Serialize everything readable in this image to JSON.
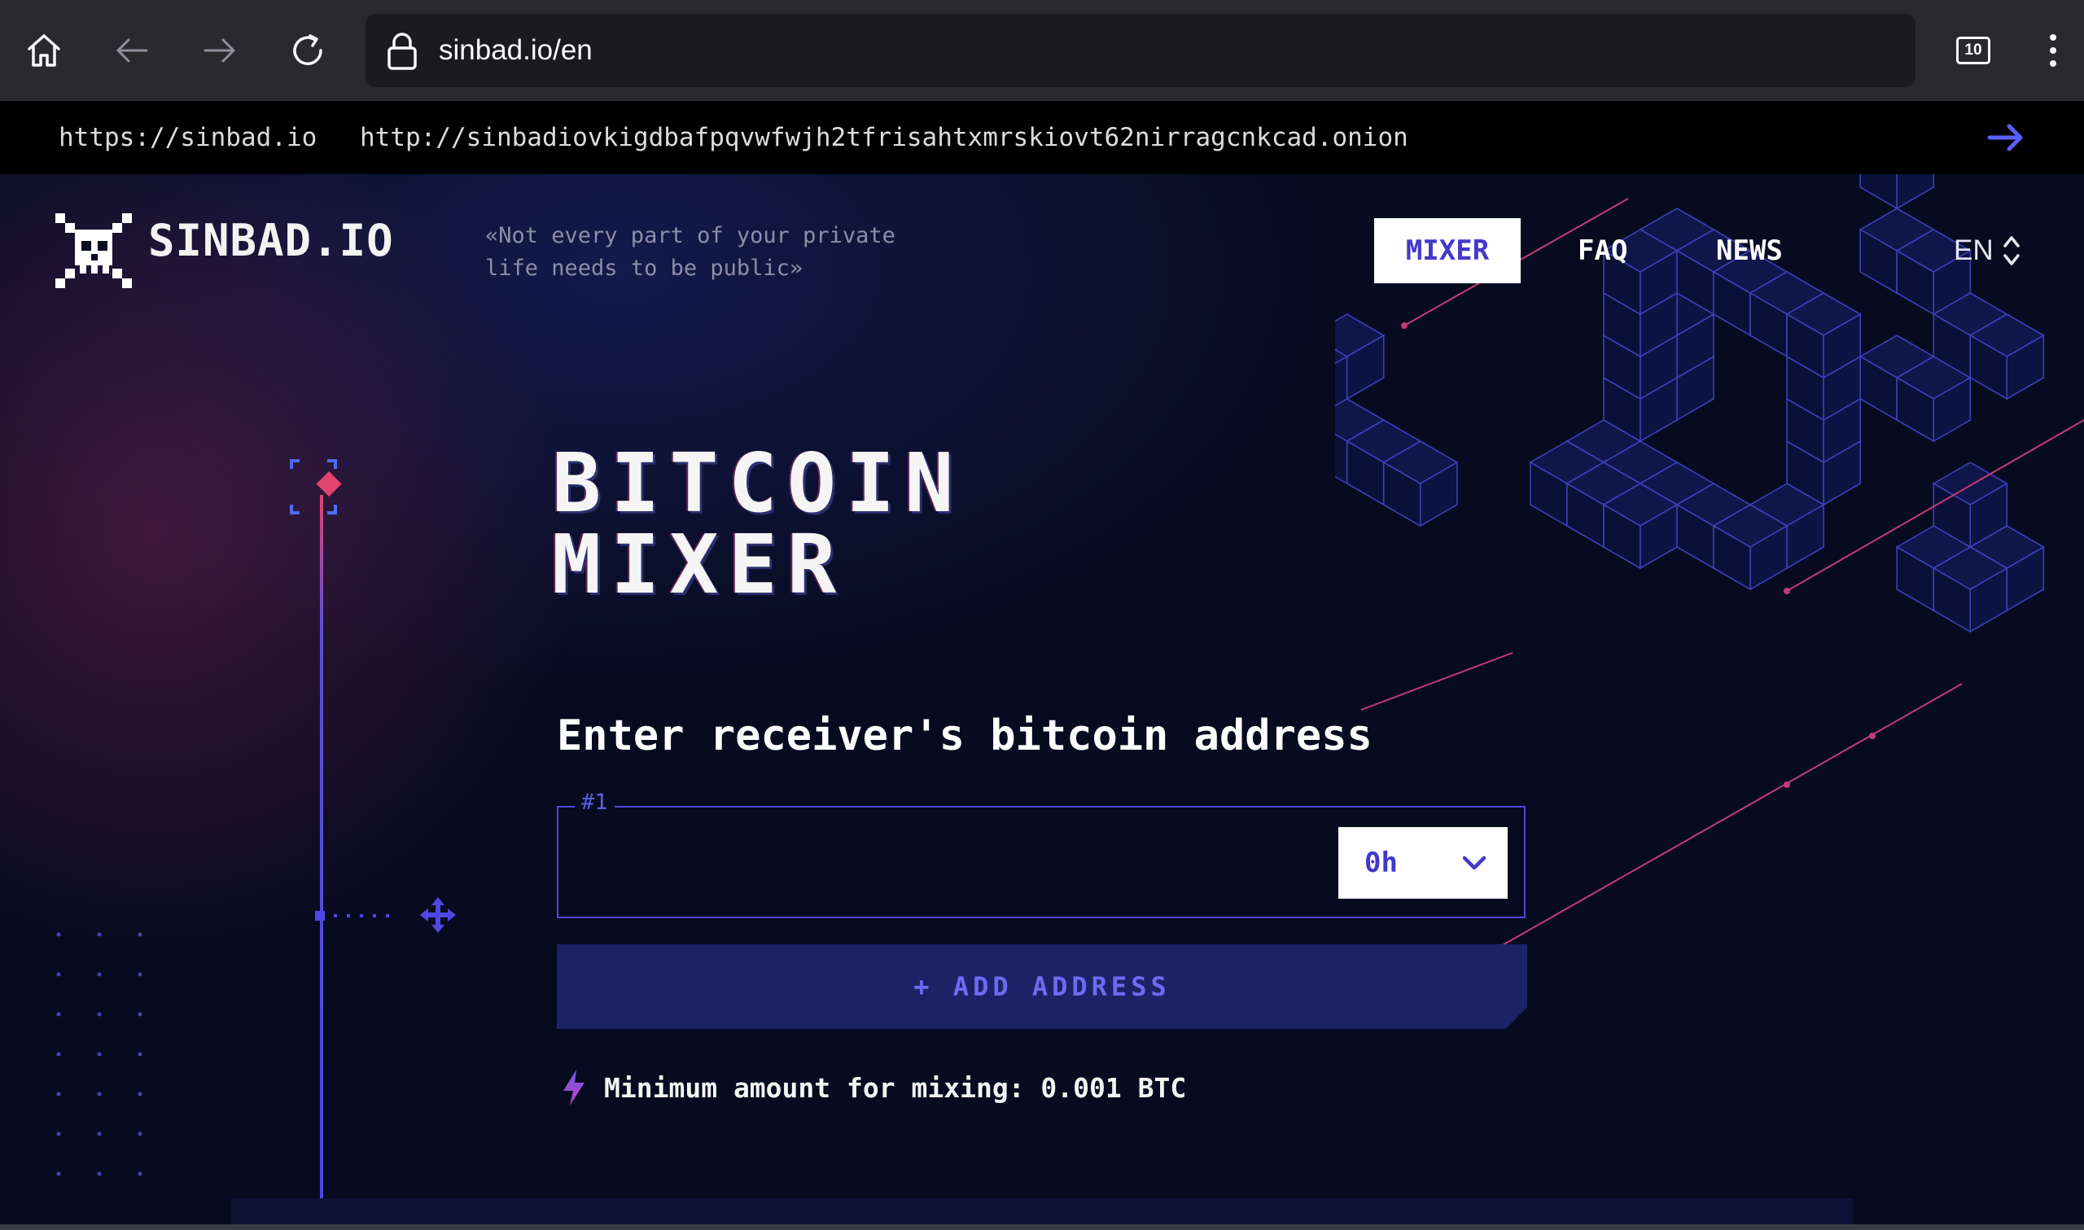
{
  "browser": {
    "url": "sinbad.io/en",
    "tab_count": "10"
  },
  "mirrors": {
    "clearnet": "https://sinbad.io",
    "onion": "http://sinbadiovkigdbafpqvwfwjh2tfrisahtxmrskiovt62nirragcnkcad.onion"
  },
  "site": {
    "logo": "SINBAD.IO",
    "tagline_line1": "«Not every part of your private",
    "tagline_line2": "life needs to be public»"
  },
  "nav": {
    "items": [
      "MIXER",
      "FAQ",
      "NEWS"
    ],
    "active": "MIXER",
    "language": "EN"
  },
  "hero": {
    "title_line1": "BITCOIN",
    "title_line2": "MIXER"
  },
  "form": {
    "heading": "Enter receiver's bitcoin address",
    "address_label": "#1",
    "address_value": "",
    "delay_value": "0h",
    "add_button": "+ ADD ADDRESS",
    "min_amount": "Minimum amount for mixing: 0.001 BTC"
  },
  "colors": {
    "accent": "#4f46e5",
    "background": "#070b1f",
    "highlight": "#e0446f"
  },
  "icons": [
    "home-icon",
    "back-arrow-icon",
    "forward-arrow-icon",
    "reload-icon",
    "lock-icon",
    "tabs-icon",
    "menu-icon",
    "arrow-right-icon",
    "skull-logo-icon",
    "sort-arrows-icon",
    "chevron-down-icon",
    "lightning-icon",
    "move-icon"
  ]
}
